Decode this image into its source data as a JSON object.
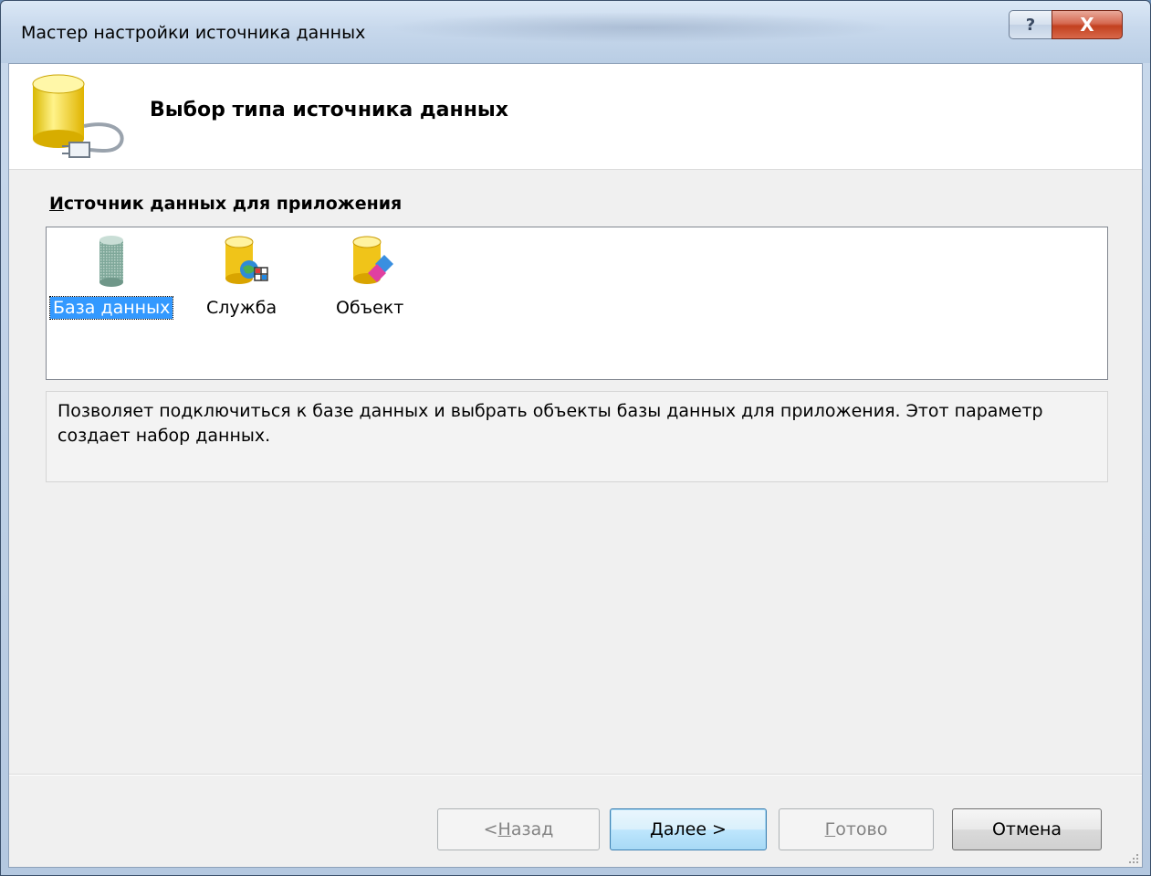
{
  "window": {
    "title": "Мастер настройки источника данных",
    "help_glyph": "?",
    "close_glyph": "X"
  },
  "header": {
    "title": "Выбор типа источника данных",
    "icon": "database-plug-icon"
  },
  "source_list": {
    "label_accel": "И",
    "label_rest": "сточник данных для приложения",
    "items": [
      {
        "label": "База данных",
        "icon": "database-icon",
        "selected": true
      },
      {
        "label": "Служба",
        "icon": "service-icon",
        "selected": false
      },
      {
        "label": "Объект",
        "icon": "object-icon",
        "selected": false
      }
    ]
  },
  "description": "Позволяет подключиться к базе данных и выбрать объекты базы данных для приложения. Этот параметр создает набор данных.",
  "buttons": {
    "back_prefix": "< ",
    "back_accel": "Н",
    "back_rest": "азад",
    "next_accel": "Д",
    "next_rest": "алее >",
    "finish_accel": "Г",
    "finish_rest": "отово",
    "cancel": "Отмена"
  },
  "colors": {
    "selection": "#3399ff",
    "close_button": "#c2401f",
    "default_button_border": "#3c7fb1"
  }
}
